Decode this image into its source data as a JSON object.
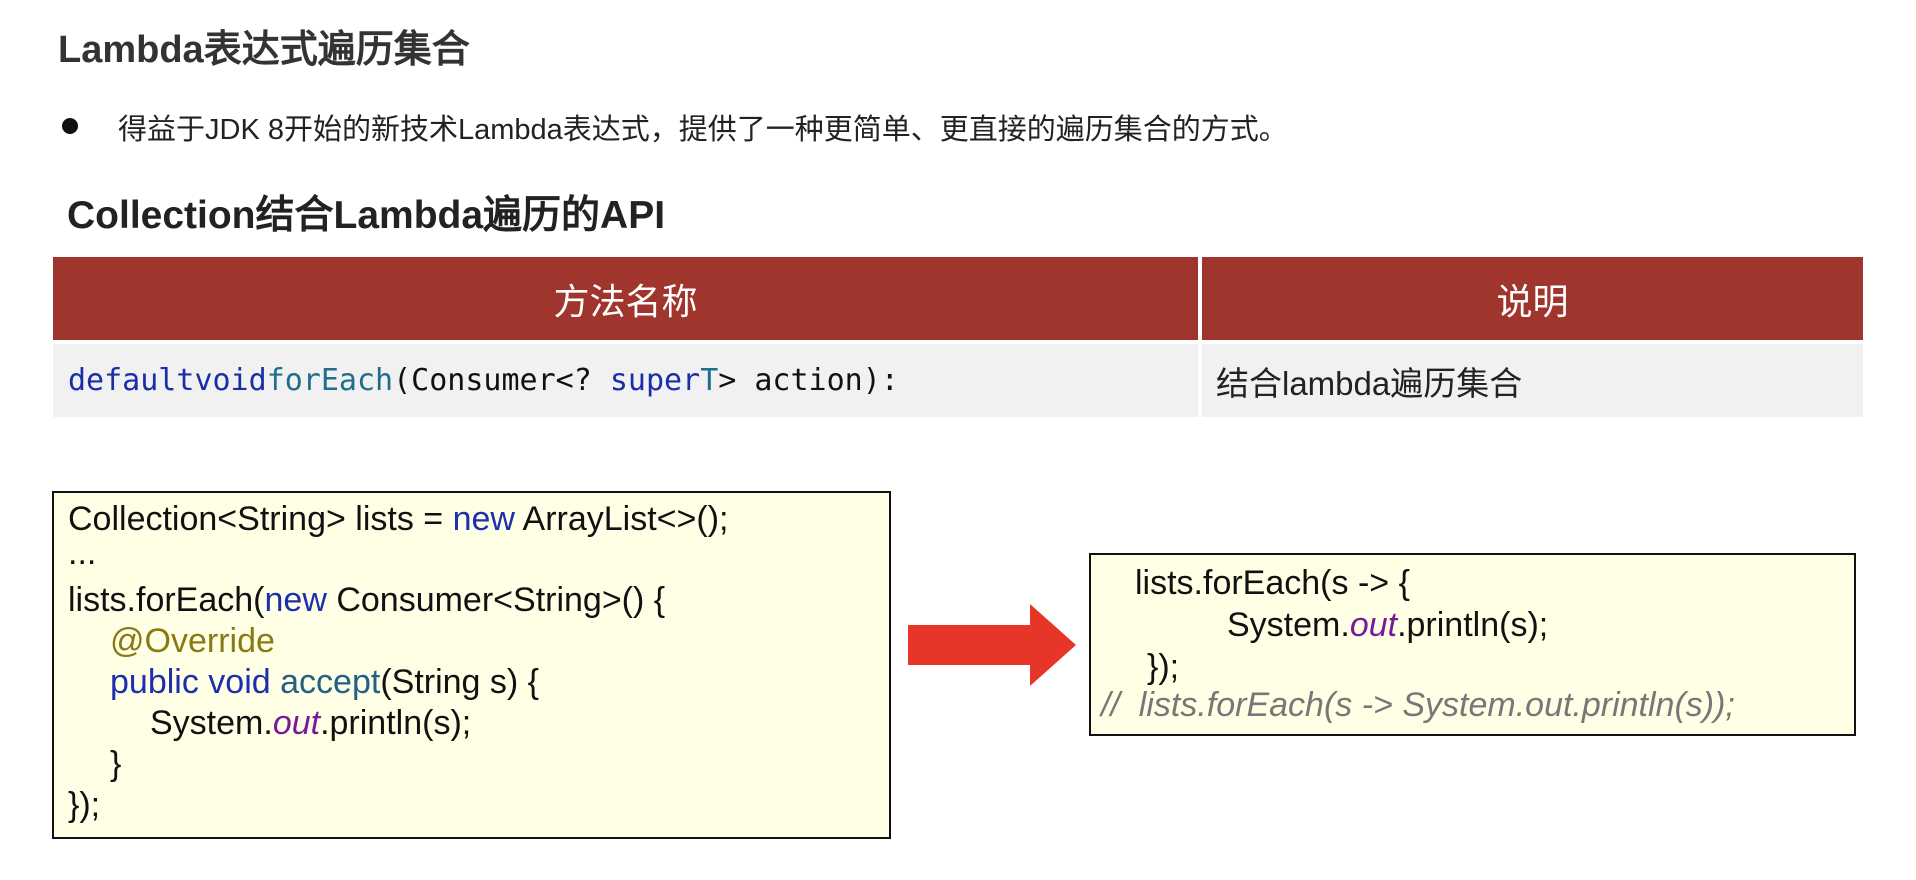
{
  "title": "Lambda表达式遍历集合",
  "bullet": "得益于JDK 8开始的新技术Lambda表达式，提供了一种更简单、更直接的遍历集合的方式。",
  "subtitle": "Collection结合Lambda遍历的API",
  "table": {
    "headers": [
      "方法名称",
      "说明"
    ],
    "row": {
      "method": {
        "kw1": "default",
        "kw2": "void",
        "name": "forEach",
        "rest1": "(Consumer<? ",
        "kw3": "super",
        "type": "T",
        "rest2": "> action):"
      },
      "description": "结合lambda遍历集合"
    }
  },
  "left_code": {
    "l1a": "Collection<String> lists = ",
    "l1b": "new",
    "l1c": " ArrayList<>();",
    "l2": "...",
    "l3a": "lists.forEach(",
    "l3b": "new",
    "l3c": " Consumer<String>() {",
    "l4": "@Override",
    "l5a": "public",
    "l5b": "void",
    "l5c": "accept",
    "l5d": "(String s) {",
    "l6a": "System.",
    "l6b": "out",
    "l6c": ".println(s);",
    "l7": "}",
    "l8": "});"
  },
  "right_code": {
    "l1": "lists.forEach(s -> {",
    "l2a": "System.",
    "l2b": "out",
    "l2c": ".println(s);",
    "l3": "});",
    "l4": "//  lists.forEach(s -> System.out.println(s));"
  },
  "colors": {
    "header_bg": "#a0352e",
    "row_bg": "#f1f1f1",
    "code_bg": "#ffffe6",
    "arrow": "#e8352a",
    "keyword": "#1d2fae"
  },
  "icons": {
    "arrow": "right-arrow-icon",
    "bullet": "bullet-dot-icon"
  }
}
